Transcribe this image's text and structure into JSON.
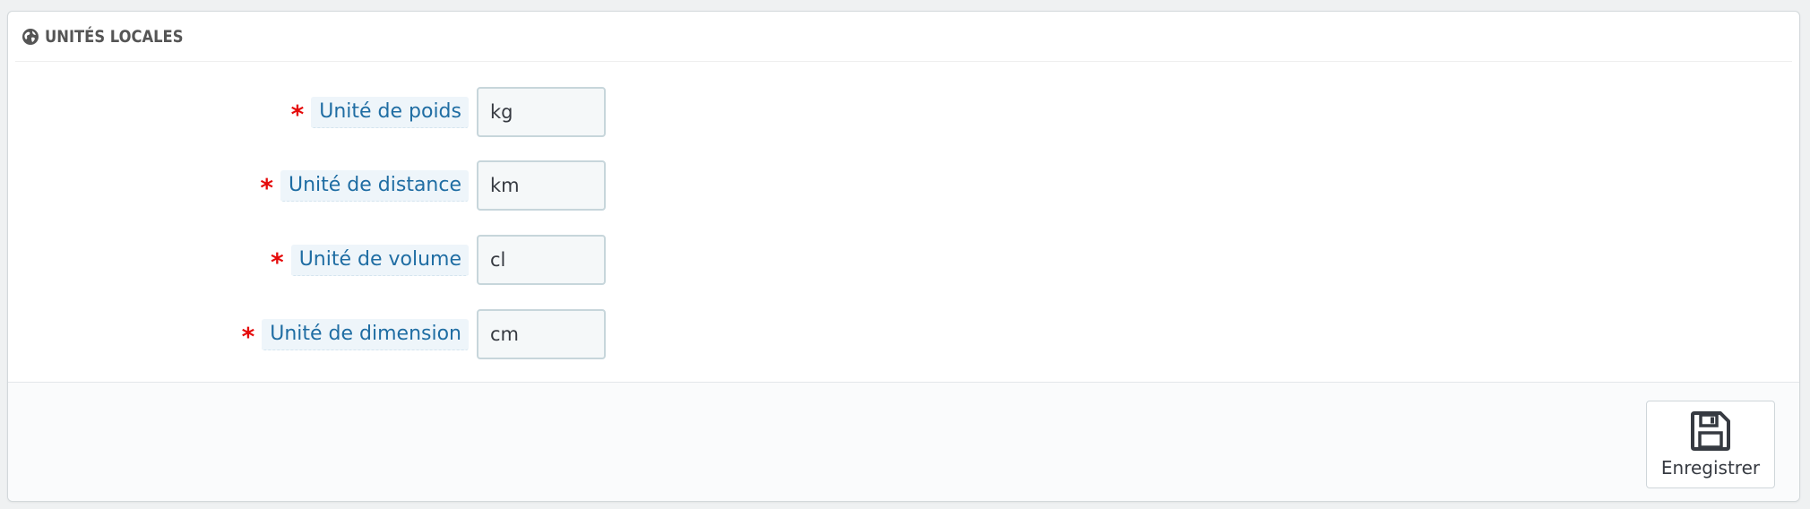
{
  "panel": {
    "heading_icon": "globe-icon",
    "title": "UNITÉS LOCALES"
  },
  "fields": [
    {
      "label": "Unité de poids",
      "required_mark": "*",
      "value": "kg"
    },
    {
      "label": "Unité de distance",
      "required_mark": "*",
      "value": "km"
    },
    {
      "label": "Unité de volume",
      "required_mark": "*",
      "value": "cl"
    },
    {
      "label": "Unité de dimension",
      "required_mark": "*",
      "value": "cm"
    }
  ],
  "footer": {
    "save_icon": "floppy-disk-icon",
    "save_label": "Enregistrer"
  },
  "colors": {
    "required": "#e50b0b",
    "label_text": "#1f6da3",
    "label_bg": "#eef5fa"
  }
}
